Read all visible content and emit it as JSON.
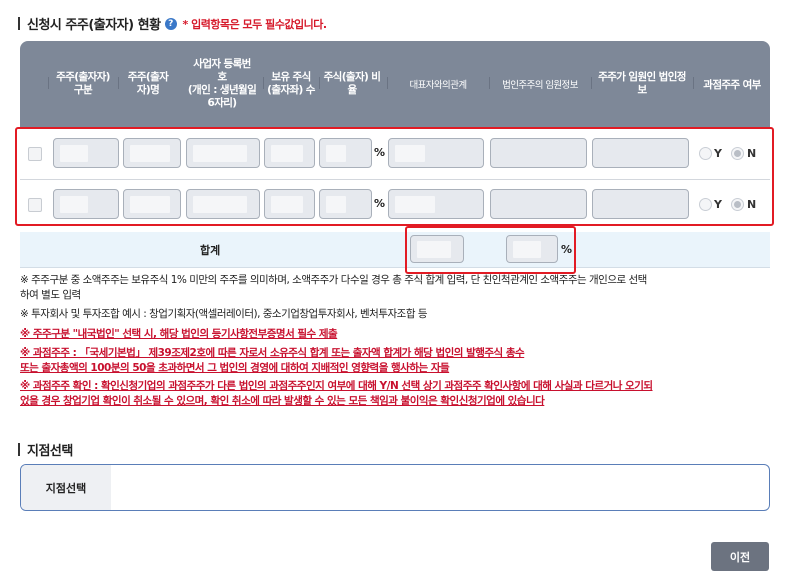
{
  "section1": {
    "title": "신청시 주주(출자자) 현황",
    "help_icon": "question-circle-icon",
    "required_note": "* 입력항목은 모두 필수값입니다."
  },
  "table": {
    "headers": {
      "type": "주주(출자자)\n구분",
      "name": "주주(출자\n자)명",
      "regno": "사업자 등록번\n호\n(개인 : 생년월일\n6자리)",
      "shares": "보유 주식\n(출자좌) 수",
      "ratio": "주식(출자) 비\n율",
      "rel": "대표자와의관계",
      "corp_officer": "법인주주의 임원정보",
      "corp_officer2": "주주가 임원인 법인정\n보",
      "major": "과점주주 여부"
    },
    "rows": [
      {
        "ratio_unit": "%",
        "major_yes": "Y",
        "major_no": "N",
        "major_selected": "N"
      },
      {
        "ratio_unit": "%",
        "major_yes": "Y",
        "major_no": "N",
        "major_selected": "N"
      }
    ],
    "total": {
      "label": "합계",
      "ratio_unit": "%"
    }
  },
  "notes": [
    {
      "text": "※ 주주구분 중 소액주주는 보유주식 1% 미만의 주주를 의미하며, 소액주주가 다수일 경우 총 주식 합계 입력, 단 친인척관계인 소액주주는 개인으로 선택\n하여 별도 입력",
      "style": "normal"
    },
    {
      "text": "※ 투자회사 및 투자조합 예시 : 창업기획자(액셀러레이터), 중소기업창업투자회사, 벤처투자조합 등",
      "style": "normal"
    },
    {
      "text": "※ 주주구분 \"내국법인\" 선택 시, 해당 법인의 등기사항전부증명서 필수 제출",
      "style": "red"
    },
    {
      "text": "※ 과점주주 : 「국세기본법」 제39조제2호에 따른 자로서 소유주식 합계 또는 출자액 합계가 해당 법인의 발행주식 총수\n또는 출자총액의 100분의 50을 초과하면서 그 법인의 경영에 대하여 지배적인 영향력을 행사하는 자들",
      "style": "red"
    },
    {
      "text": "※ 과점주주 확인 : 확인신청기업의 과점주주가 다른 법인의 과점주주인지 여부에 대해 Y/N 선택 상기 과점주주 확인사항에 대해 사실과 다르거나 오기되\n었을 경우 창업기업 확인이 취소될 수 있으며, 확인 취소에 따라 발생할 수 있는 모든 책임과 불이익은 확인신청기업에 있습니다",
      "style": "red"
    }
  ],
  "section2": {
    "title": "지점선택",
    "field_label": "지점선택"
  },
  "buttons": {
    "prev": "이전"
  }
}
